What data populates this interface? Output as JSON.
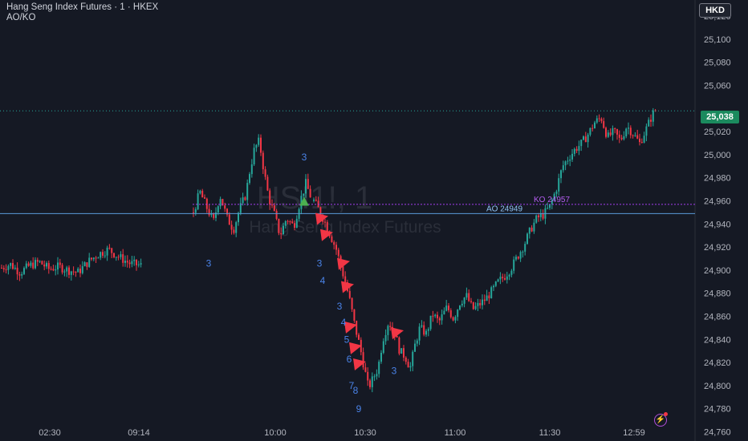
{
  "header": {
    "title": "Hang Seng Index Futures · 1 · HKEX",
    "indicator": "AO/KO"
  },
  "currency": "HKD",
  "watermark": {
    "symbol": "HSI1!, 1",
    "name": "Hang Seng Index Futures"
  },
  "colors": {
    "up": "#26a69a",
    "down": "#f23645",
    "ao_line": "#5a9bd8",
    "ko_line": "#a53ef0",
    "count_text": "#4a83e8",
    "background": "#151924"
  },
  "last_price": {
    "label": "25,038",
    "value": 25038
  },
  "levels": {
    "ao": {
      "label": "AO 24949",
      "value": 24949
    },
    "ko": {
      "label": "KO 24957",
      "value": 24957
    }
  },
  "chart_data": {
    "type": "candlestick",
    "y_ticks": [
      24760,
      24780,
      24800,
      24820,
      24840,
      24860,
      24880,
      24900,
      24920,
      24940,
      24960,
      24980,
      25000,
      25020,
      25040,
      25060,
      25080,
      25100,
      25120
    ],
    "y_tick_labels": [
      "24,760",
      "24,780",
      "24,800",
      "24,820",
      "24,840",
      "24,860",
      "24,880",
      "24,900",
      "24,920",
      "24,940",
      "24,960",
      "24,980",
      "25,000",
      "25,020",
      "",
      "25,060",
      "25,080",
      "25,100",
      "25,120"
    ],
    "x_tick_labels": [
      "02:30",
      "09:14",
      "10:00",
      "10:30",
      "11:00",
      "11:30",
      "12:59"
    ],
    "ylim": [
      24752,
      25134
    ],
    "segments": [
      {
        "path": [
          [
            24902,
            1
          ],
          [
            24905,
            12
          ],
          [
            24898,
            24
          ],
          [
            24904,
            36
          ],
          [
            24907,
            48
          ],
          [
            24901,
            60
          ],
          [
            24903,
            72
          ],
          [
            24900,
            84
          ],
          [
            24898,
            96
          ],
          [
            24908,
            110
          ],
          [
            24914,
            122
          ],
          [
            24918,
            134
          ],
          [
            24912,
            146
          ],
          [
            24906,
            160
          ],
          [
            24904,
            175
          ]
        ]
      },
      {
        "path": [
          [
            24950,
            240
          ],
          [
            24968,
            248
          ],
          [
            24955,
            256
          ],
          [
            24942,
            265
          ],
          [
            24965,
            273
          ],
          [
            24945,
            282
          ],
          [
            24935,
            290
          ],
          [
            24952,
            297
          ],
          [
            24965,
            305
          ],
          [
            24985,
            310
          ],
          [
            25005,
            316
          ],
          [
            25012,
            322
          ],
          [
            24985,
            328
          ],
          [
            24962,
            334
          ],
          [
            24948,
            341
          ],
          [
            24930,
            348
          ],
          [
            24945,
            356
          ],
          [
            24938,
            365
          ],
          [
            24960,
            373
          ],
          [
            24975,
            380
          ],
          [
            24960,
            388
          ]
        ]
      },
      {
        "path": [
          [
            24960,
            390
          ],
          [
            24950,
            398
          ],
          [
            24940,
            405
          ],
          [
            24928,
            412
          ],
          [
            24918,
            418
          ],
          [
            24900,
            425
          ],
          [
            24888,
            430
          ],
          [
            24870,
            436
          ],
          [
            24852,
            441
          ],
          [
            24835,
            447
          ],
          [
            24815,
            453
          ],
          [
            24798,
            458
          ],
          [
            24805,
            463
          ],
          [
            24815,
            470
          ],
          [
            24840,
            476
          ],
          [
            24855,
            483
          ],
          [
            24848,
            490
          ],
          [
            24830,
            497
          ],
          [
            24825,
            504
          ],
          [
            24815,
            510
          ],
          [
            24835,
            516
          ],
          [
            24850,
            522
          ],
          [
            24845,
            530
          ],
          [
            24862,
            538
          ],
          [
            24855,
            546
          ],
          [
            24868,
            556
          ],
          [
            24858,
            564
          ],
          [
            24872,
            572
          ],
          [
            24878,
            580
          ],
          [
            24866,
            588
          ],
          [
            24870,
            596
          ],
          [
            24875,
            604
          ],
          [
            24882,
            612
          ],
          [
            24890,
            620
          ],
          [
            24895,
            628
          ],
          [
            24902,
            636
          ],
          [
            24912,
            644
          ],
          [
            24922,
            652
          ],
          [
            24935,
            660
          ],
          [
            24945,
            668
          ],
          [
            24948,
            676
          ],
          [
            24955,
            684
          ],
          [
            24970,
            692
          ],
          [
            24990,
            700
          ],
          [
            24998,
            708
          ],
          [
            25005,
            716
          ],
          [
            25010,
            724
          ],
          [
            25018,
            732
          ],
          [
            25028,
            740
          ],
          [
            25032,
            748
          ],
          [
            25015,
            756
          ],
          [
            25020,
            764
          ],
          [
            25012,
            772
          ],
          [
            25025,
            780
          ],
          [
            25018,
            788
          ],
          [
            25010,
            796
          ],
          [
            25022,
            804
          ],
          [
            25035,
            812
          ],
          [
            25040,
            817
          ]
        ]
      }
    ],
    "buy_signals": [
      {
        "x": 379,
        "price": 24960
      }
    ],
    "sell_signals": [
      {
        "x": 398,
        "price": 24944
      },
      {
        "x": 404,
        "price": 24930
      },
      {
        "x": 425,
        "price": 24905
      },
      {
        "x": 430,
        "price": 24885
      },
      {
        "x": 434,
        "price": 24850
      },
      {
        "x": 440,
        "price": 24832
      },
      {
        "x": 445,
        "price": 24818
      },
      {
        "x": 492,
        "price": 24845
      }
    ],
    "sequence_counts": [
      {
        "text": "3",
        "x": 379,
        "price": 24995
      },
      {
        "text": "3",
        "x": 260,
        "price": 24903
      },
      {
        "text": "3",
        "x": 398,
        "price": 24903
      },
      {
        "text": "4",
        "x": 402,
        "price": 24888
      },
      {
        "text": "3",
        "x": 423,
        "price": 24866
      },
      {
        "text": "4",
        "x": 428,
        "price": 24852
      },
      {
        "text": "5",
        "x": 432,
        "price": 24837
      },
      {
        "text": "6",
        "x": 435,
        "price": 24820
      },
      {
        "text": "7",
        "x": 438,
        "price": 24797
      },
      {
        "text": "8",
        "x": 443,
        "price": 24793
      },
      {
        "text": "9",
        "x": 447,
        "price": 24777
      },
      {
        "text": "3",
        "x": 491,
        "price": 24810
      }
    ]
  }
}
